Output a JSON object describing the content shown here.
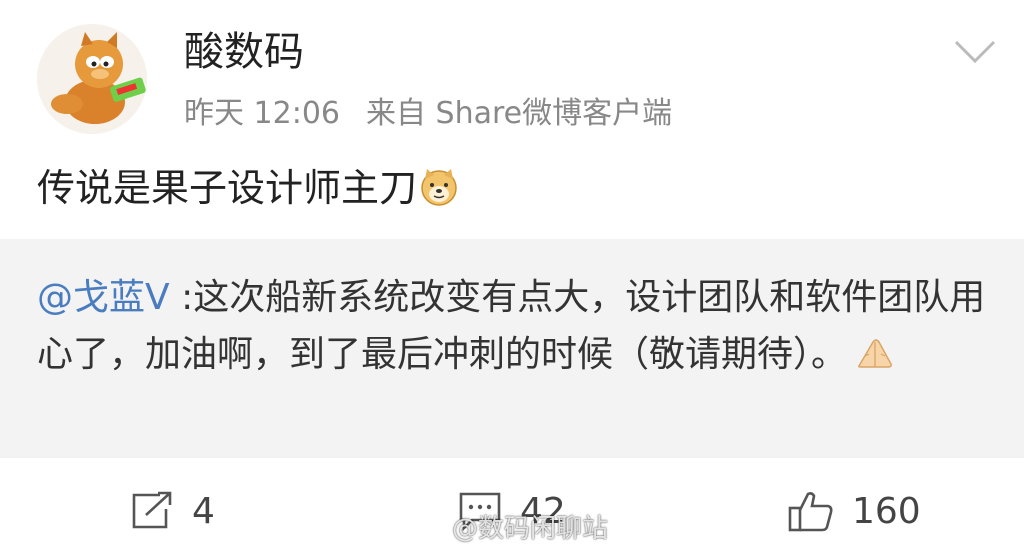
{
  "header": {
    "username": "酸数码",
    "time": "昨天 12:06",
    "source": "来自 Share微博客户端"
  },
  "post": {
    "text": "传说是果子设计师主刀"
  },
  "repost": {
    "mention": "@戈蓝V",
    "text": " :这次船新系统改变有点大，设计团队和软件团队用心了，加油啊，到了最后冲刺的时候（敬请期待）。"
  },
  "actions": {
    "share_count": "4",
    "comment_count": "42",
    "like_count": "160"
  },
  "watermark": {
    "text": "@数码闲聊站"
  },
  "colors": {
    "mention": "#4a7dbf",
    "repost_bg": "#f3f3f3",
    "meta": "#888888"
  },
  "icons": [
    "garfield-avatar",
    "chevron-down-icon",
    "doge-emoji",
    "praying-hands-emoji",
    "share-icon",
    "comment-icon",
    "like-icon",
    "weibo-logo-icon"
  ]
}
